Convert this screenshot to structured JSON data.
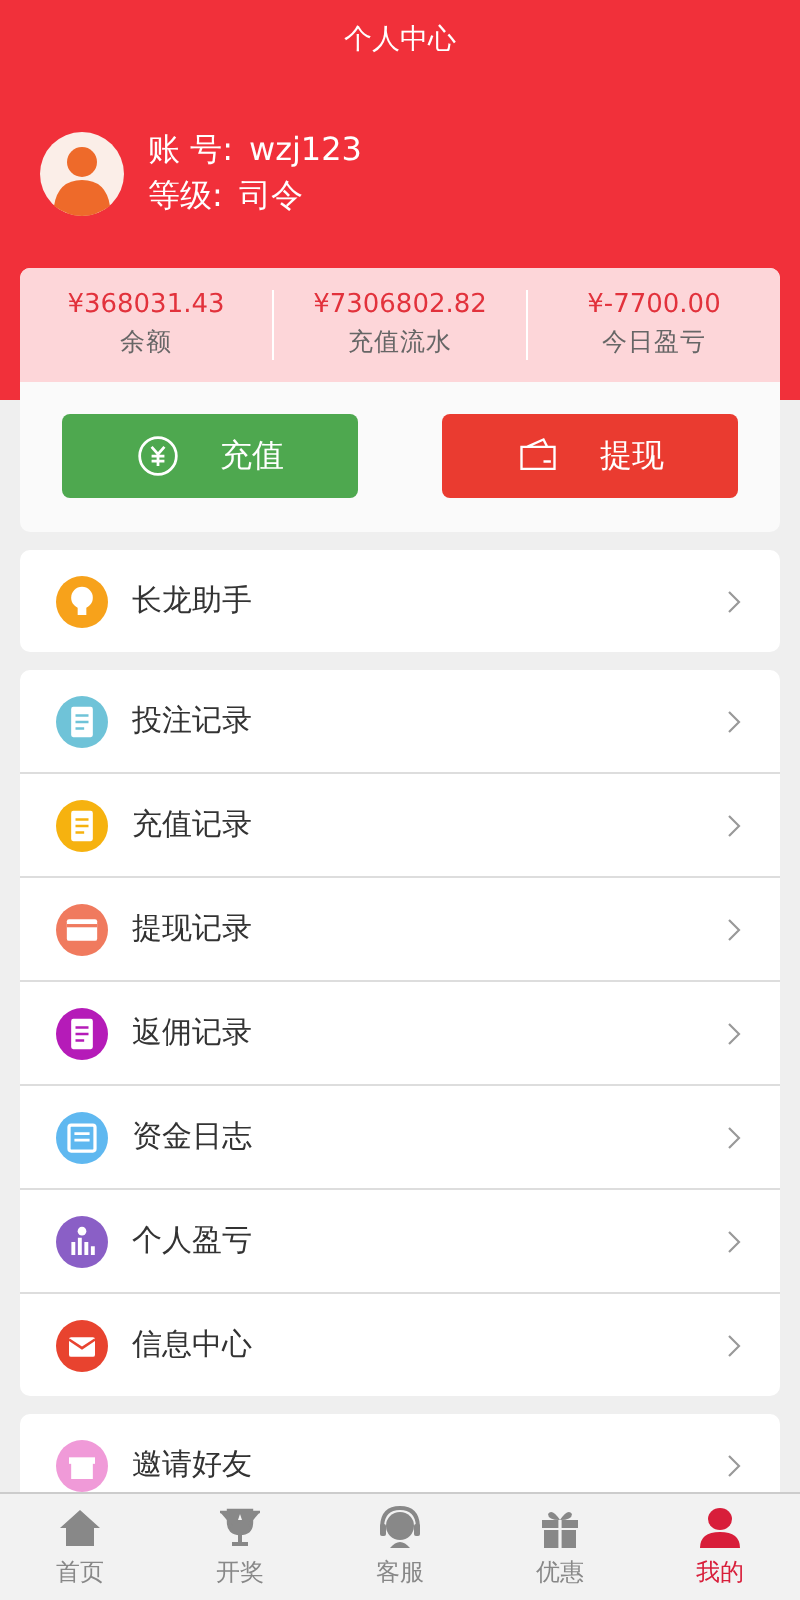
{
  "header": {
    "title": "个人中心"
  },
  "profile": {
    "account_label": "账 号:",
    "account": "wzj123",
    "level_label": "等级:",
    "level": "司令"
  },
  "stats": [
    {
      "value": "¥368031.43",
      "label": "余额"
    },
    {
      "value": "¥7306802.82",
      "label": "充值流水"
    },
    {
      "value": "¥-7700.00",
      "label": "今日盈亏"
    }
  ],
  "actions": [
    {
      "kind": "deposit",
      "label": "充值"
    },
    {
      "kind": "withdraw",
      "label": "提现"
    }
  ],
  "menu_groups": [
    {
      "items": [
        {
          "label": "长龙助手",
          "kind": "bulb",
          "color": "#f7a21b"
        }
      ]
    },
    {
      "items": [
        {
          "label": "投注记录",
          "kind": "doc",
          "color": "#6fc3d8"
        },
        {
          "label": "充值记录",
          "kind": "doc",
          "color": "#f6b20f"
        },
        {
          "label": "提现记录",
          "kind": "card",
          "color": "#f07a5e"
        },
        {
          "label": "返佣记录",
          "kind": "doc",
          "color": "#b51bb8"
        },
        {
          "label": "资金日志",
          "kind": "frame",
          "color": "#5fb8f0"
        },
        {
          "label": "个人盈亏",
          "kind": "chart",
          "color": "#8a5fc6"
        },
        {
          "label": "信息中心",
          "kind": "mail",
          "color": "#e8432f"
        }
      ]
    },
    {
      "items": [
        {
          "label": "邀请好友",
          "kind": "gift",
          "color": "#f09ad8"
        }
      ]
    }
  ],
  "tabs": [
    {
      "label": "首页",
      "kind": "house",
      "selected": false
    },
    {
      "label": "开奖",
      "kind": "trophy",
      "selected": false
    },
    {
      "label": "客服",
      "kind": "headset",
      "selected": false
    },
    {
      "label": "优惠",
      "kind": "gift",
      "selected": false
    },
    {
      "label": "我的",
      "kind": "person",
      "selected": true
    }
  ]
}
